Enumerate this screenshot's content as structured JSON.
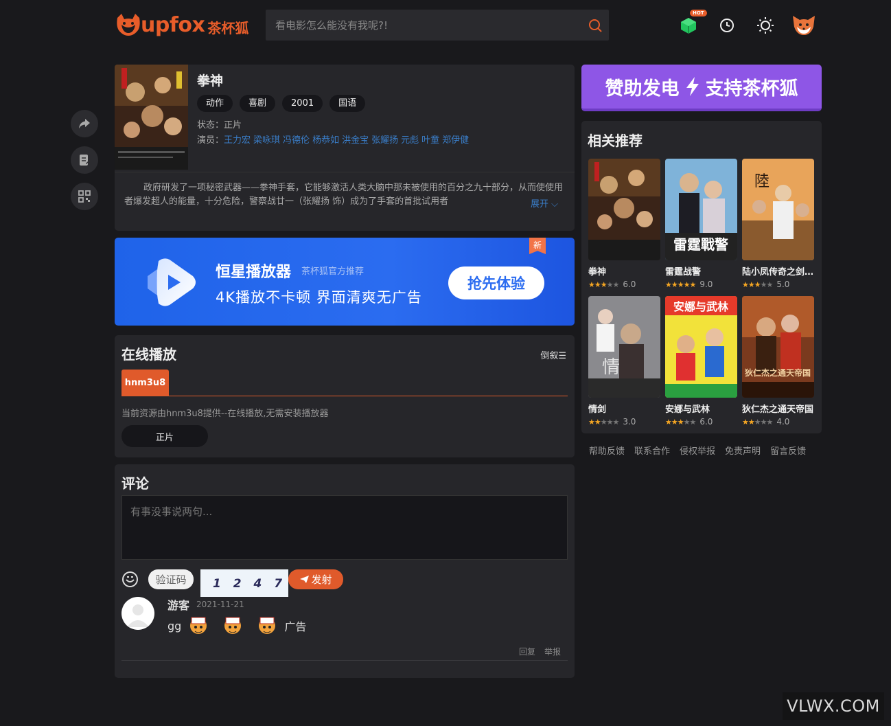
{
  "header": {
    "logo_text": "upfox",
    "logo_cn": "茶杯狐",
    "search_placeholder": "看电影怎么能没有我呢?!",
    "hot_badge": "HOT",
    "icons": [
      "cube-icon",
      "history-icon",
      "theme-icon",
      "fox-avatar-icon"
    ]
  },
  "side_tools": [
    "share-icon",
    "note-icon",
    "qrcode-icon"
  ],
  "detail": {
    "title": "拳神",
    "tags": [
      "动作",
      "喜剧",
      "2001",
      "国语"
    ],
    "status_label": "状态：",
    "status_value": "正片",
    "actors_label": "演员：",
    "actors": [
      "王力宏",
      "梁咏琪",
      "冯德伦",
      "杨恭如",
      "洪金宝",
      "张耀扬",
      "元彪",
      "叶童",
      "郑伊健"
    ],
    "description": "政府研发了一项秘密武器——拳神手套，它能够激活人类大脑中那未被使用的百分之九十部分，从而使使用者爆发超人的能量，十分危险，警察战廿一（张耀扬 饰）成为了手套的首批试用者",
    "expand": "展开"
  },
  "ad": {
    "title": "恒星播放器",
    "sub": "茶杯狐官方推荐",
    "slogan": "4K播放不卡顿  界面清爽无广告",
    "button": "抢先体验",
    "new_badge": "新"
  },
  "play": {
    "title": "在线播放",
    "sort": "倒叙",
    "source_tab": "hnm3u8",
    "source_note": "当前资源由hnm3u8提供--在线播放,无需安装播放器",
    "episode": "正片"
  },
  "comments": {
    "title": "评论",
    "placeholder": "有事没事说两句...",
    "captcha_placeholder": "验证码",
    "captcha_text": "1 2 4 7",
    "send": "发射",
    "items": [
      {
        "user": "游客",
        "date": "2021-11-21",
        "text_before": "gg",
        "text_after": "广告",
        "reply": "回复",
        "report": "举报"
      }
    ]
  },
  "donate": {
    "left": "赞助发电",
    "right": "支持茶杯狐"
  },
  "related": {
    "title": "相关推荐",
    "items": [
      {
        "name": "拳神",
        "rating": "6.0",
        "stars": 3
      },
      {
        "name": "雷霆战警",
        "rating": "9.0",
        "stars": 5
      },
      {
        "name": "陆小凤传奇之剑神一笑",
        "rating": "5.0",
        "stars": 3
      },
      {
        "name": "情剑",
        "rating": "3.0",
        "stars": 2
      },
      {
        "name": "安娜与武林",
        "rating": "6.0",
        "stars": 3
      },
      {
        "name": "狄仁杰之通天帝国",
        "rating": "4.0",
        "stars": 2
      }
    ]
  },
  "footer_links": [
    "帮助反馈",
    "联系合作",
    "侵权举报",
    "免责声明",
    "留言反馈"
  ],
  "watermark": "VLWX.COM",
  "colors": {
    "accent": "#e85d2a",
    "link": "#3a7ec9",
    "donate": "#8e56e6",
    "ad_blue": "#2b6cf0"
  }
}
